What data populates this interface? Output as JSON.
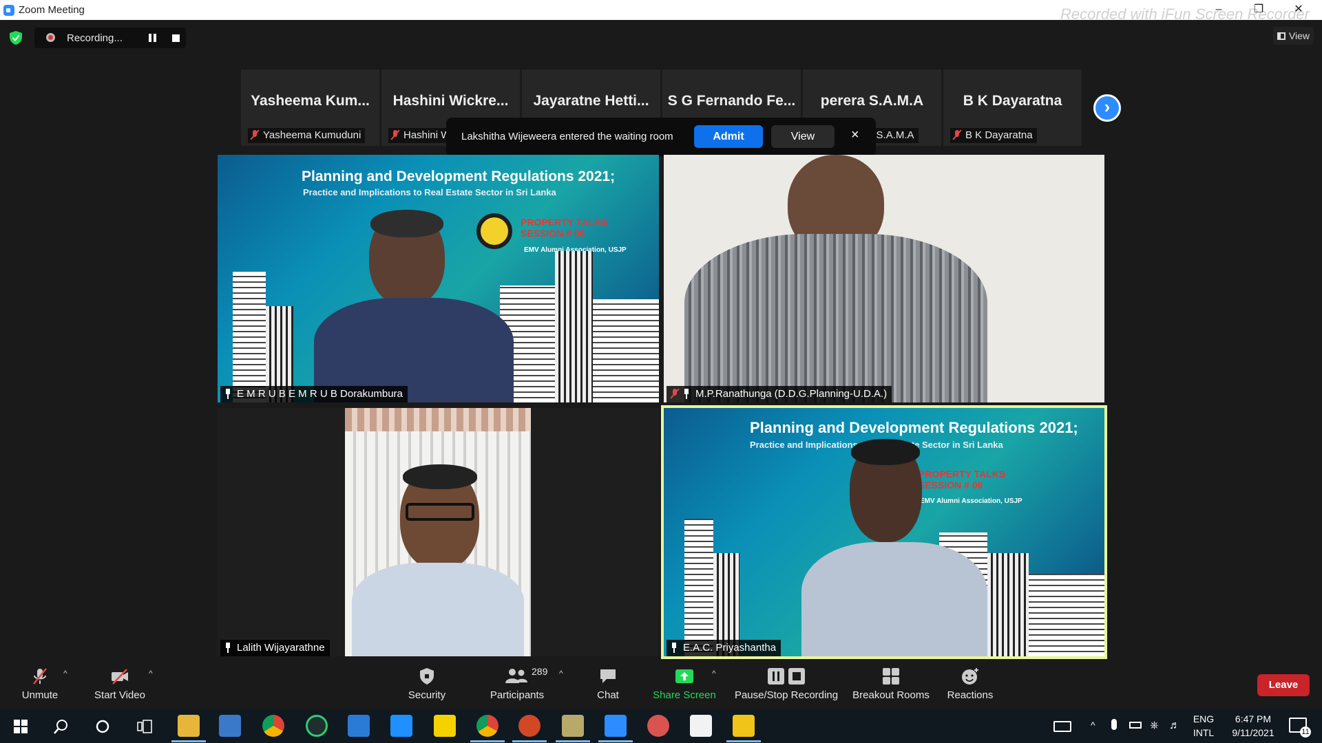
{
  "window": {
    "title": "Zoom Meeting",
    "watermark": "Recorded with iFun Screen Recorder",
    "controls": [
      "–",
      "❐",
      "✕"
    ]
  },
  "top_bar": {
    "recording_label": "Recording...",
    "view_label": "View"
  },
  "participants_strip": [
    {
      "display_name": "Yasheema  Kum...",
      "label": "Yasheema Kumuduni",
      "muted": true
    },
    {
      "display_name": "Hashini  Wickre...",
      "label": "Hashini Wickremasinghe",
      "muted": true
    },
    {
      "display_name": "Jayaratne  Hetti...",
      "label": "",
      "muted": false
    },
    {
      "display_name": "S G Fernando Fe...",
      "label": "S G Fernando",
      "muted": false
    },
    {
      "display_name": "perera S.A.M.A",
      "label": "perera S.A.M.A",
      "muted": false
    },
    {
      "display_name": "B K Dayaratna",
      "label": "B K Dayaratna",
      "muted": true
    }
  ],
  "notification": {
    "message": "Lakshitha Wijeweera entered the waiting room",
    "admit_label": "Admit",
    "view_label": "View",
    "close": "×"
  },
  "videos": [
    {
      "name": "E M R U B E M R U B Dorakumbura",
      "muted": false
    },
    {
      "name": "M.P.Ranathunga (D.D.G.Planning-U.D.A.)",
      "muted": true
    },
    {
      "name": "Lalith Wijayarathne",
      "muted": false
    },
    {
      "name": "E.A.C. Priyashantha",
      "muted": false,
      "active_speaker": true
    }
  ],
  "slide": {
    "title": "Planning and Development Regulations 2021;",
    "subtitle": "Practice and Implications to Real Estate Sector in Sri Lanka",
    "badge_line1": "PROPERTY TALKS",
    "badge_line2": "SESSION # 06",
    "org": "EMV Alumni Association, USJP"
  },
  "toolbar": {
    "unmute": "Unmute",
    "start_video": "Start Video",
    "security": "Security",
    "participants": "Participants",
    "participants_count": "289",
    "chat": "Chat",
    "share_screen": "Share Screen",
    "pause_stop": "Pause/Stop Recording",
    "breakout": "Breakout Rooms",
    "reactions": "Reactions",
    "leave": "Leave"
  },
  "taskbar": {
    "lang1": "ENG",
    "lang2": "INTL",
    "time": "6:47 PM",
    "date": "9/11/2021",
    "notif_count": "11"
  },
  "colors": {
    "zoom_blue": "#2d8cff",
    "leave_red": "#c8242a",
    "share_green": "#23d959",
    "active_speaker_border": "#e8f59a"
  }
}
